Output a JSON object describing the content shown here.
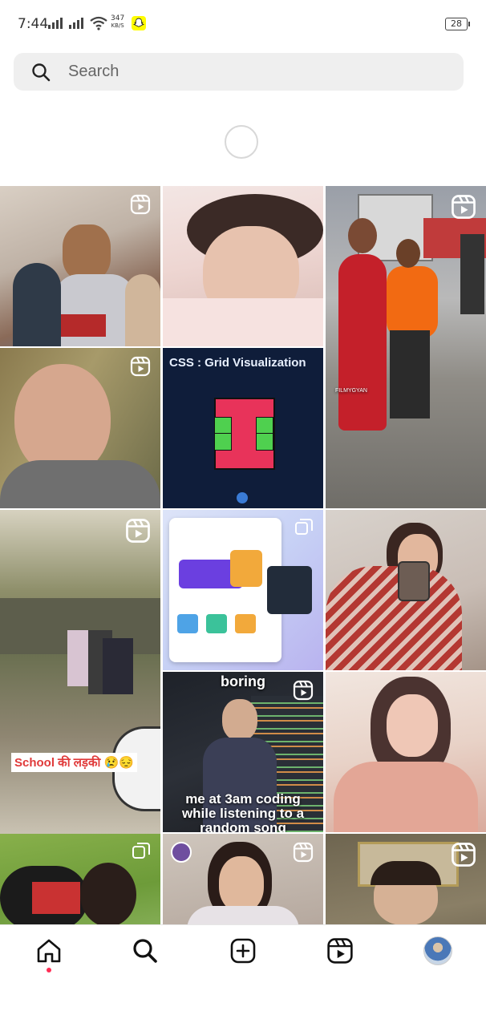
{
  "status_bar": {
    "time": "7:44",
    "network_speed_value": "347",
    "network_speed_unit": "KB/S",
    "battery": "28"
  },
  "search": {
    "placeholder": "Search",
    "icon": "search-icon"
  },
  "explore_grid": {
    "tiles": [
      {
        "badge": "reel-icon",
        "overlay_text": ""
      },
      {
        "badge": "",
        "overlay_text": ""
      },
      {
        "badge": "reel-icon",
        "overlay_text": "FILMYGYAN"
      },
      {
        "badge": "reel-icon",
        "overlay_text": ""
      },
      {
        "badge": "",
        "overlay_text": "CSS : Grid Visualization"
      },
      {
        "badge": "reel-icon",
        "overlay_text": ""
      },
      {
        "badge": "multi-post-icon",
        "overlay_text": ""
      },
      {
        "badge": "",
        "overlay_text": ""
      },
      {
        "badge": "reel-icon",
        "overlay_text": "School की लड़की 😢😔"
      },
      {
        "badge": "reel-icon",
        "overlay_text_top": "boring",
        "overlay_text": "me at 3am coding while listening to a random song"
      },
      {
        "badge": "",
        "overlay_text": ""
      },
      {
        "badge": "multi-post-icon",
        "overlay_text": ""
      },
      {
        "badge": "reel-icon",
        "overlay_text": ""
      },
      {
        "badge": "reel-icon",
        "overlay_text": ""
      }
    ]
  },
  "bottom_nav": {
    "items": [
      "home-icon",
      "search-icon",
      "create-post-icon",
      "reels-icon",
      "profile-avatar"
    ],
    "active": "home",
    "accent": "#ff2d55"
  }
}
